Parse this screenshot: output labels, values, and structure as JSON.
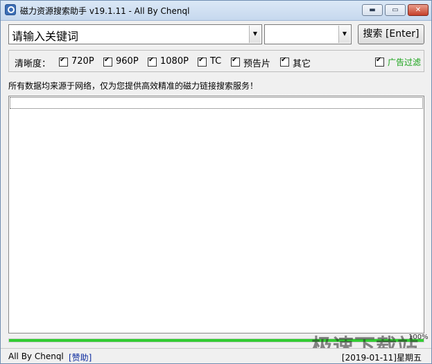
{
  "window": {
    "title": "磁力资源搜索助手 v19.1.11 - All By Chenql",
    "minimize_icon": "minimize-icon",
    "maximize_icon": "maximize-icon",
    "close_icon": "close-icon"
  },
  "search": {
    "keyword_value": "请输入关键词",
    "secondary_value": "",
    "button_label": "搜索 [Enter]"
  },
  "filters": {
    "label": "清晰度：",
    "options": [
      {
        "label": "720P",
        "checked": true
      },
      {
        "label": "960P",
        "checked": true
      },
      {
        "label": "1080P",
        "checked": true
      },
      {
        "label": "TC",
        "checked": true
      },
      {
        "label": "预告片",
        "checked": true
      },
      {
        "label": "其它",
        "checked": true
      }
    ],
    "ad_filter": {
      "label": "广告过滤",
      "checked": true,
      "color": "#1aa31a"
    }
  },
  "notice": "所有数据均来源于网络，仅为您提供高效精准的磁力链接搜索服务！",
  "progress": {
    "percent": 100,
    "text": "100%",
    "color": "#33cc33"
  },
  "status": {
    "author": "All By Chenql",
    "donate": "[赞助]",
    "date": "[2019-01-11]星期五"
  },
  "watermark": "极速下载站"
}
